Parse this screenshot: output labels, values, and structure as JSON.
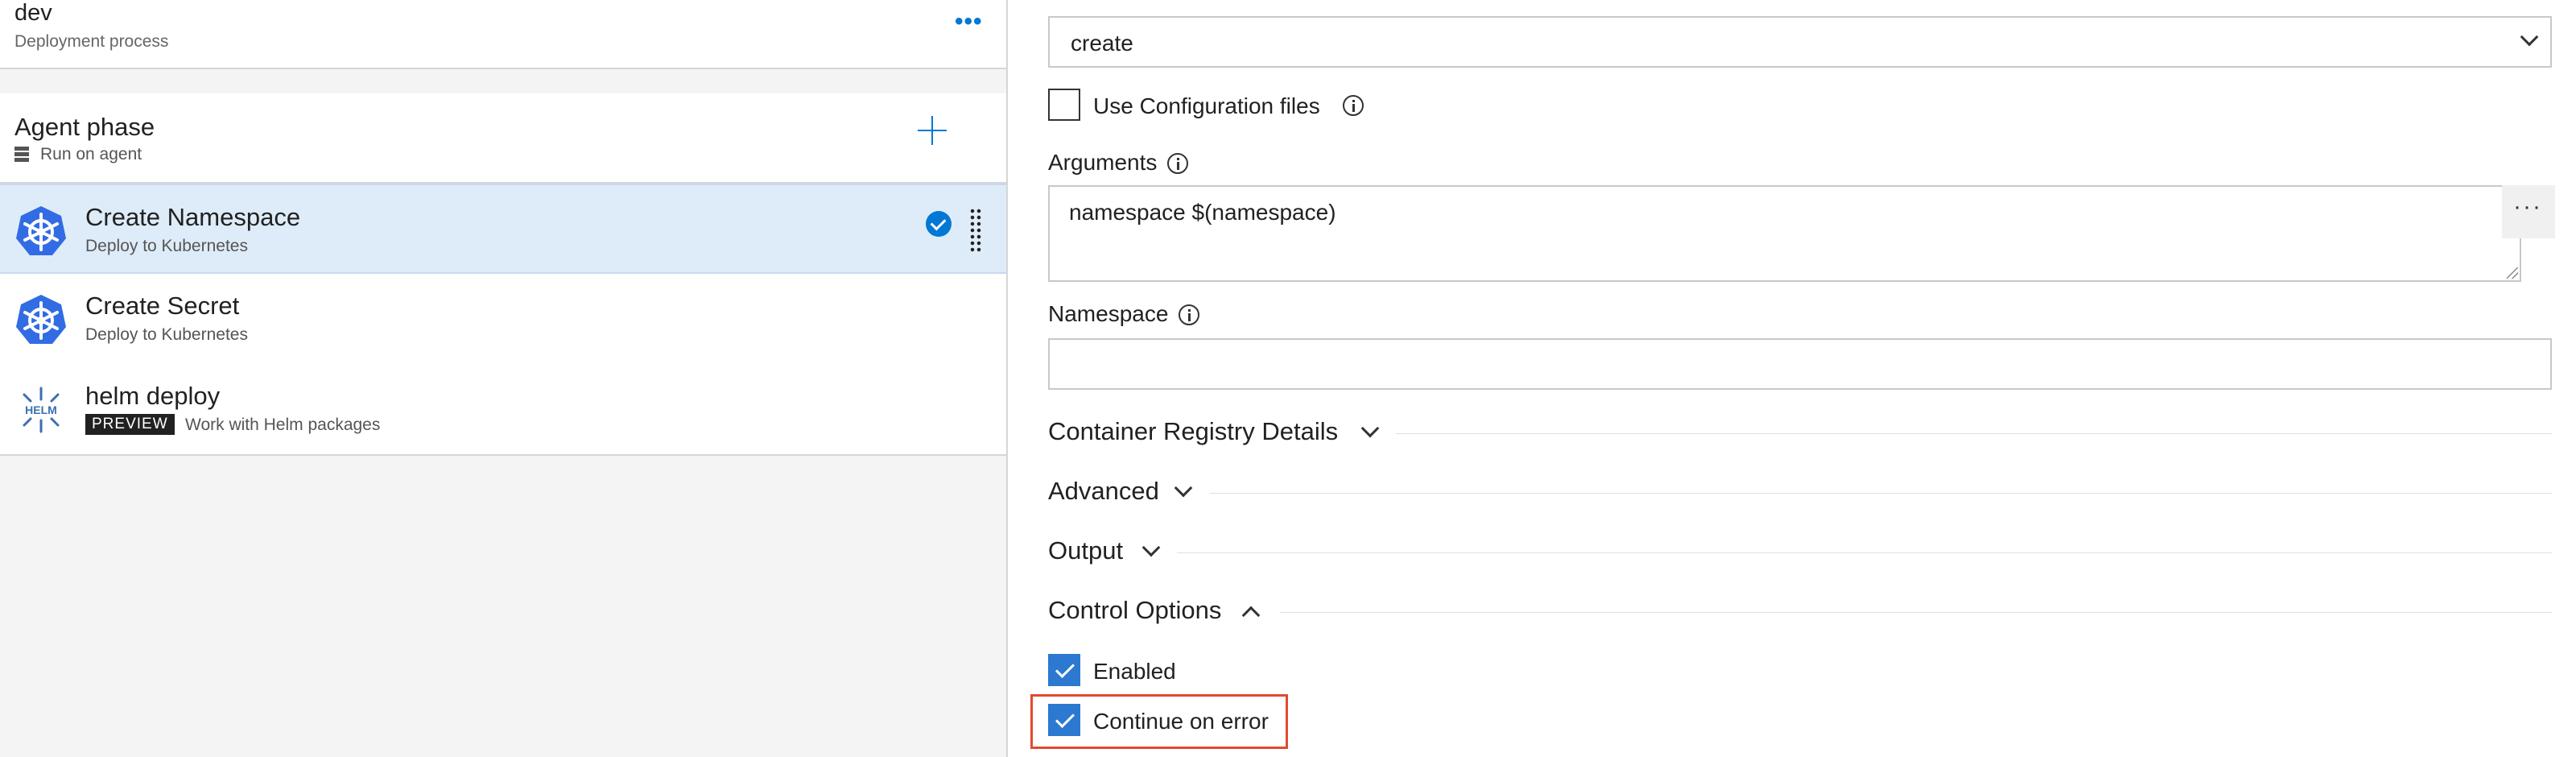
{
  "left": {
    "environment": {
      "name": "dev",
      "subtitle": "Deployment process"
    },
    "phase": {
      "title": "Agent phase",
      "subtitle": "Run on agent"
    },
    "tasks": [
      {
        "title": "Create Namespace",
        "subtitle": "Deploy to Kubernetes",
        "selected": true
      },
      {
        "title": "Create Secret",
        "subtitle": "Deploy to Kubernetes",
        "selected": false
      },
      {
        "title": "helm deploy",
        "badge": "PREVIEW",
        "subtitle": "Work with Helm packages",
        "selected": false
      }
    ]
  },
  "right": {
    "command": {
      "value": "create"
    },
    "use_config_files": {
      "label": "Use Configuration files",
      "checked": false
    },
    "arguments": {
      "label": "Arguments",
      "value": "namespace $(namespace)"
    },
    "namespace": {
      "label": "Namespace",
      "value": ""
    },
    "sections": [
      {
        "title": "Container Registry Details",
        "expanded": false
      },
      {
        "title": "Advanced",
        "expanded": false
      },
      {
        "title": "Output",
        "expanded": false
      },
      {
        "title": "Control Options",
        "expanded": true
      }
    ],
    "enabled": {
      "label": "Enabled",
      "checked": true
    },
    "continue_on_error": {
      "label": "Continue on error",
      "checked": true
    }
  },
  "colors": {
    "accent": "#0078d4",
    "selected_row": "#deecf9",
    "highlight_box": "#e24a2e"
  }
}
